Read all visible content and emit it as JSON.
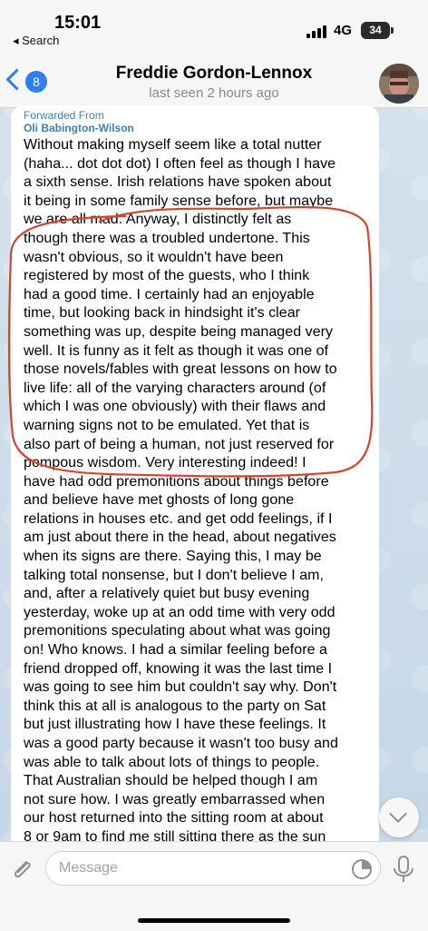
{
  "status_bar": {
    "time": "15:01",
    "back_app": "◂ Search",
    "network": "4G",
    "battery": "34"
  },
  "header": {
    "back_count": "8",
    "title": "Freddie Gordon-Lennox",
    "subtitle": "last seen 2 hours ago"
  },
  "message": {
    "forwarded_label": "Forwarded From",
    "forwarded_name": "Oli Babington-Wilson",
    "lines": [
      "Without making myself seem like a total nutter",
      "(haha... dot dot dot) I often feel as though I have",
      "a sixth sense. Irish relations have spoken about",
      "it being in some family sense before, but maybe",
      "we are all mad. Anyway, I distinctly felt as",
      "though there was a troubled undertone. This",
      "wasn't obvious, so it wouldn't have been",
      "registered by most of the guests, who I think",
      "had a good time. I certainly had an enjoyable",
      "time, but looking back in hindsight it's clear",
      "something was up, despite being managed very",
      "well. It is funny as it felt as though it was one of",
      "those novels/fables with great lessons on how to",
      "live life: all of the varying characters around (of",
      "which I was one obviously) with their flaws and",
      "warning signs not to be emulated. Yet that is",
      "also part of being a human, not just reserved for",
      "pompous wisdom. Very interesting indeed! I",
      "have had odd premonitions about things before",
      "and believe have met ghosts of long gone",
      "relations in houses etc. and get odd feelings, if I",
      "am just about there in the head, about negatives",
      "when its signs are there. Saying this, I may be",
      "talking total nonsense, but I don't believe I am,",
      "and, after a relatively quiet but busy evening",
      "yesterday, woke up at an odd time with very odd",
      "premonitions speculating about what was going",
      "on! Who knows. I had a similar feeling before a",
      "friend dropped off, knowing it was the last time I",
      "was going to see him but couldn't say why. Don't",
      "think this at all is analogous to the party on Sat",
      "but just illustrating how I have these feelings. It",
      "was a good party because it wasn't too busy and",
      "was able to talk about lots of things to people.",
      "That Australian should be helped though I am",
      "not sure how. I was greatly embarrassed when",
      "our host returned into the sitting room at about",
      "8 or 9am to find me still sitting there as the sun"
    ]
  },
  "input": {
    "placeholder": "Message"
  },
  "annotation_color": "#d9432b",
  "accent_color": "#2d7ff0"
}
